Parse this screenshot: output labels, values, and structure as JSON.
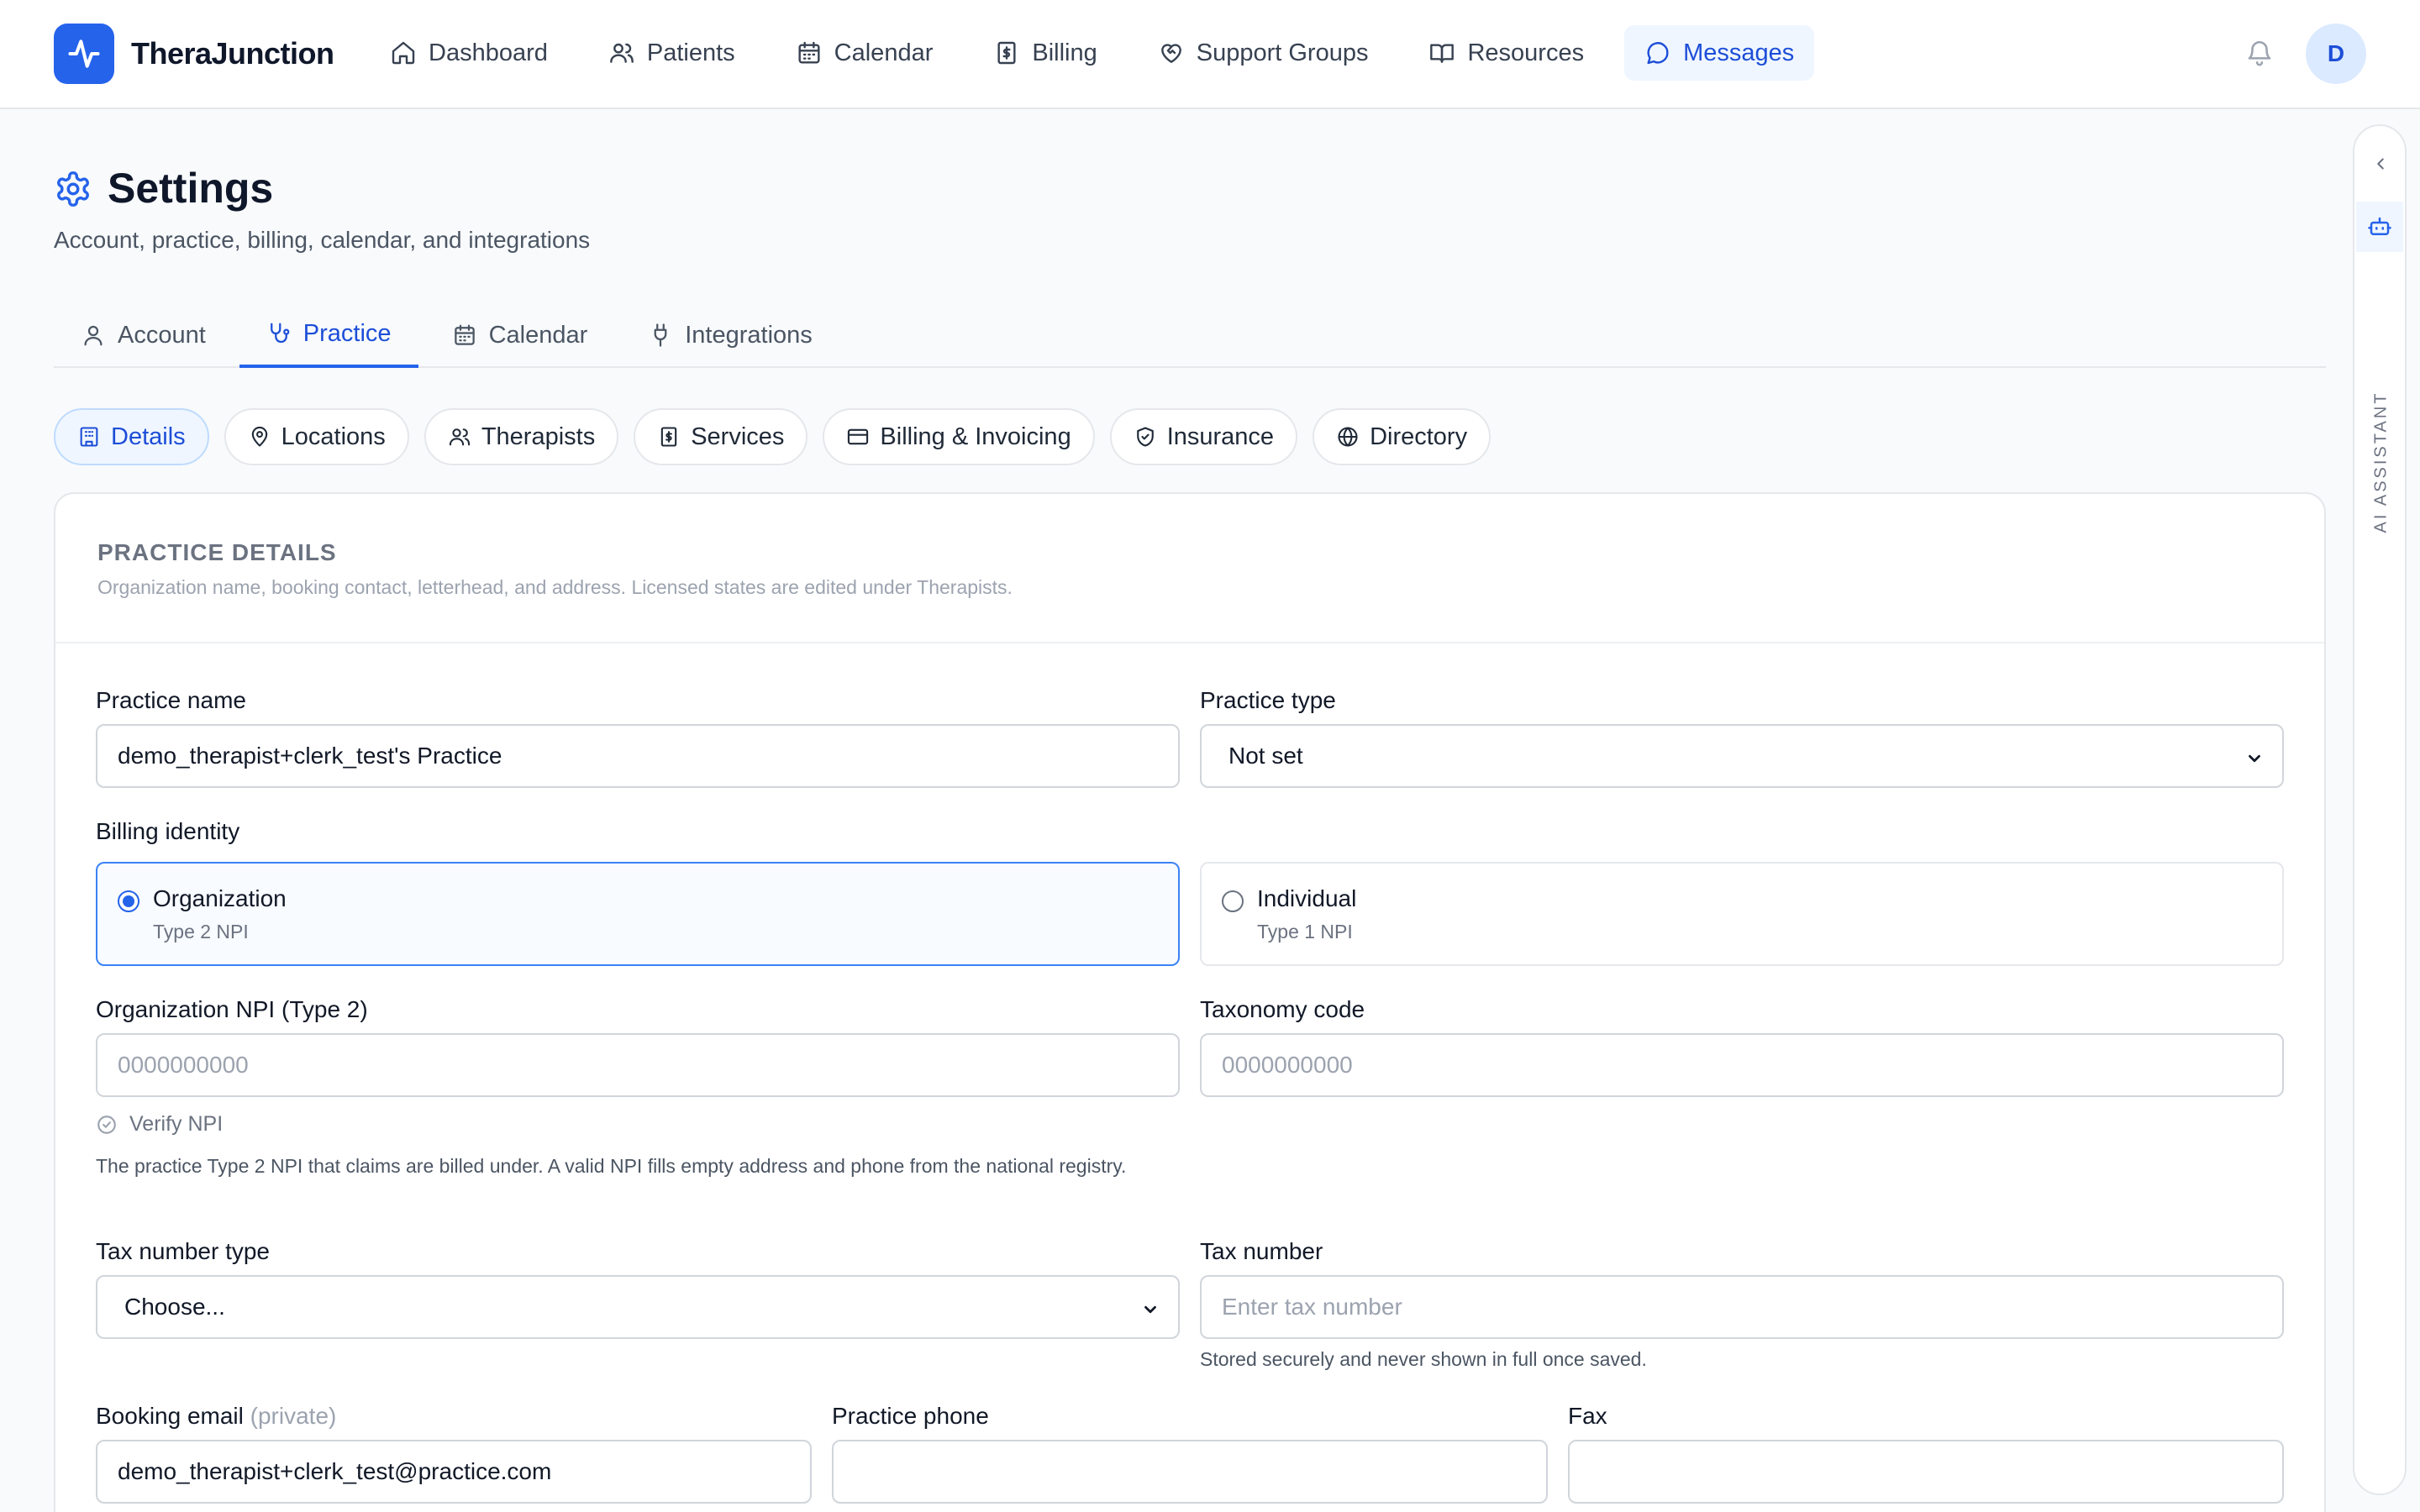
{
  "app": {
    "brand": "TheraJunction",
    "accent": "#2563eb",
    "nav": [
      {
        "label": "Dashboard",
        "icon": "home-icon"
      },
      {
        "label": "Patients",
        "icon": "users-icon"
      },
      {
        "label": "Calendar",
        "icon": "calendar-icon"
      },
      {
        "label": "Billing",
        "icon": "receipt-icon"
      },
      {
        "label": "Support Groups",
        "icon": "heart-handshake-icon"
      },
      {
        "label": "Resources",
        "icon": "book-open-icon"
      },
      {
        "label": "Messages",
        "icon": "message-circle-icon",
        "active": true
      }
    ],
    "user_initial": "D"
  },
  "page": {
    "title": "Settings",
    "subtitle": "Account, practice, billing, calendar, and integrations"
  },
  "tabs": [
    {
      "label": "Account",
      "icon": "user-icon"
    },
    {
      "label": "Practice",
      "icon": "stethoscope-icon",
      "active": true
    },
    {
      "label": "Calendar",
      "icon": "calendar-icon"
    },
    {
      "label": "Integrations",
      "icon": "plug-icon"
    }
  ],
  "subtabs": [
    {
      "label": "Details",
      "icon": "building-icon",
      "active": true
    },
    {
      "label": "Locations",
      "icon": "map-pin-icon"
    },
    {
      "label": "Therapists",
      "icon": "users-icon"
    },
    {
      "label": "Services",
      "icon": "receipt-icon"
    },
    {
      "label": "Billing & Invoicing",
      "icon": "credit-card-icon"
    },
    {
      "label": "Insurance",
      "icon": "shield-check-icon"
    },
    {
      "label": "Directory",
      "icon": "globe-icon"
    }
  ],
  "card": {
    "title": "PRACTICE DETAILS",
    "description": "Organization name, booking contact, letterhead, and address. Licensed states are edited under Therapists."
  },
  "form": {
    "practice_name": {
      "label": "Practice name",
      "value": "demo_therapist+clerk_test's Practice"
    },
    "practice_type": {
      "label": "Practice type",
      "value": "Not set"
    },
    "billing_identity": {
      "label": "Billing identity",
      "options": [
        {
          "title": "Organization",
          "sub": "Type 2 NPI",
          "selected": true
        },
        {
          "title": "Individual",
          "sub": "Type 1 NPI",
          "selected": false
        }
      ]
    },
    "org_npi": {
      "label": "Organization NPI (Type 2)",
      "placeholder": "0000000000",
      "verify_label": "Verify NPI",
      "help": "The practice Type 2 NPI that claims are billed under. A valid NPI fills empty address and phone from the national registry."
    },
    "taxonomy": {
      "label": "Taxonomy code",
      "placeholder": "0000000000"
    },
    "tax_type": {
      "label": "Tax number type",
      "value": "Choose..."
    },
    "tax_number": {
      "label": "Tax number",
      "placeholder": "Enter tax number",
      "help": "Stored securely and never shown in full once saved."
    },
    "booking_email": {
      "label": "Booking email",
      "label_note": "(private)",
      "value": "demo_therapist+clerk_test@practice.com"
    },
    "practice_phone": {
      "label": "Practice phone",
      "value": ""
    },
    "fax": {
      "label": "Fax",
      "value": ""
    }
  },
  "side_panel": {
    "label": "AI ASSISTANT"
  }
}
